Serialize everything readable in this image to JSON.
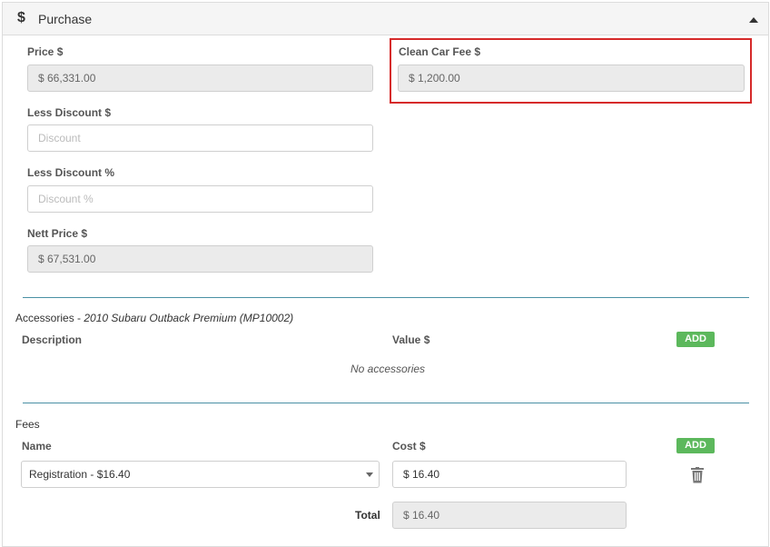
{
  "header": {
    "icon": "dollar-icon",
    "symbol": "$",
    "title": "Purchase",
    "collapse_icon": "caret-up-icon"
  },
  "purchase": {
    "price_label": "Price $",
    "price_value": "$ 66,331.00",
    "clean_car_fee_label": "Clean Car Fee $",
    "clean_car_fee_value": "$ 1,200.00",
    "less_discount_label": "Less Discount $",
    "less_discount_placeholder": "Discount",
    "less_discount_pct_label": "Less Discount %",
    "less_discount_pct_placeholder": "Discount %",
    "nett_price_label": "Nett Price $",
    "nett_price_value": "$ 67,531.00"
  },
  "accessories": {
    "title": "Accessories - ",
    "vehicle": "2010 Subaru Outback Premium (MP10002)",
    "col_description": "Description",
    "col_value": "Value $",
    "add_label": "ADD",
    "empty_text": "No accessories"
  },
  "fees": {
    "title": "Fees",
    "col_name": "Name",
    "col_cost": "Cost $",
    "add_label": "ADD",
    "row_name": "Registration - $16.40",
    "row_cost": "$ 16.40",
    "delete_icon": "trash-icon",
    "total_label": "Total",
    "total_value": "$ 16.40"
  },
  "colors": {
    "accent_green": "#5cb85c",
    "highlight_red": "#d62a2a",
    "divider": "#4a90a4"
  }
}
